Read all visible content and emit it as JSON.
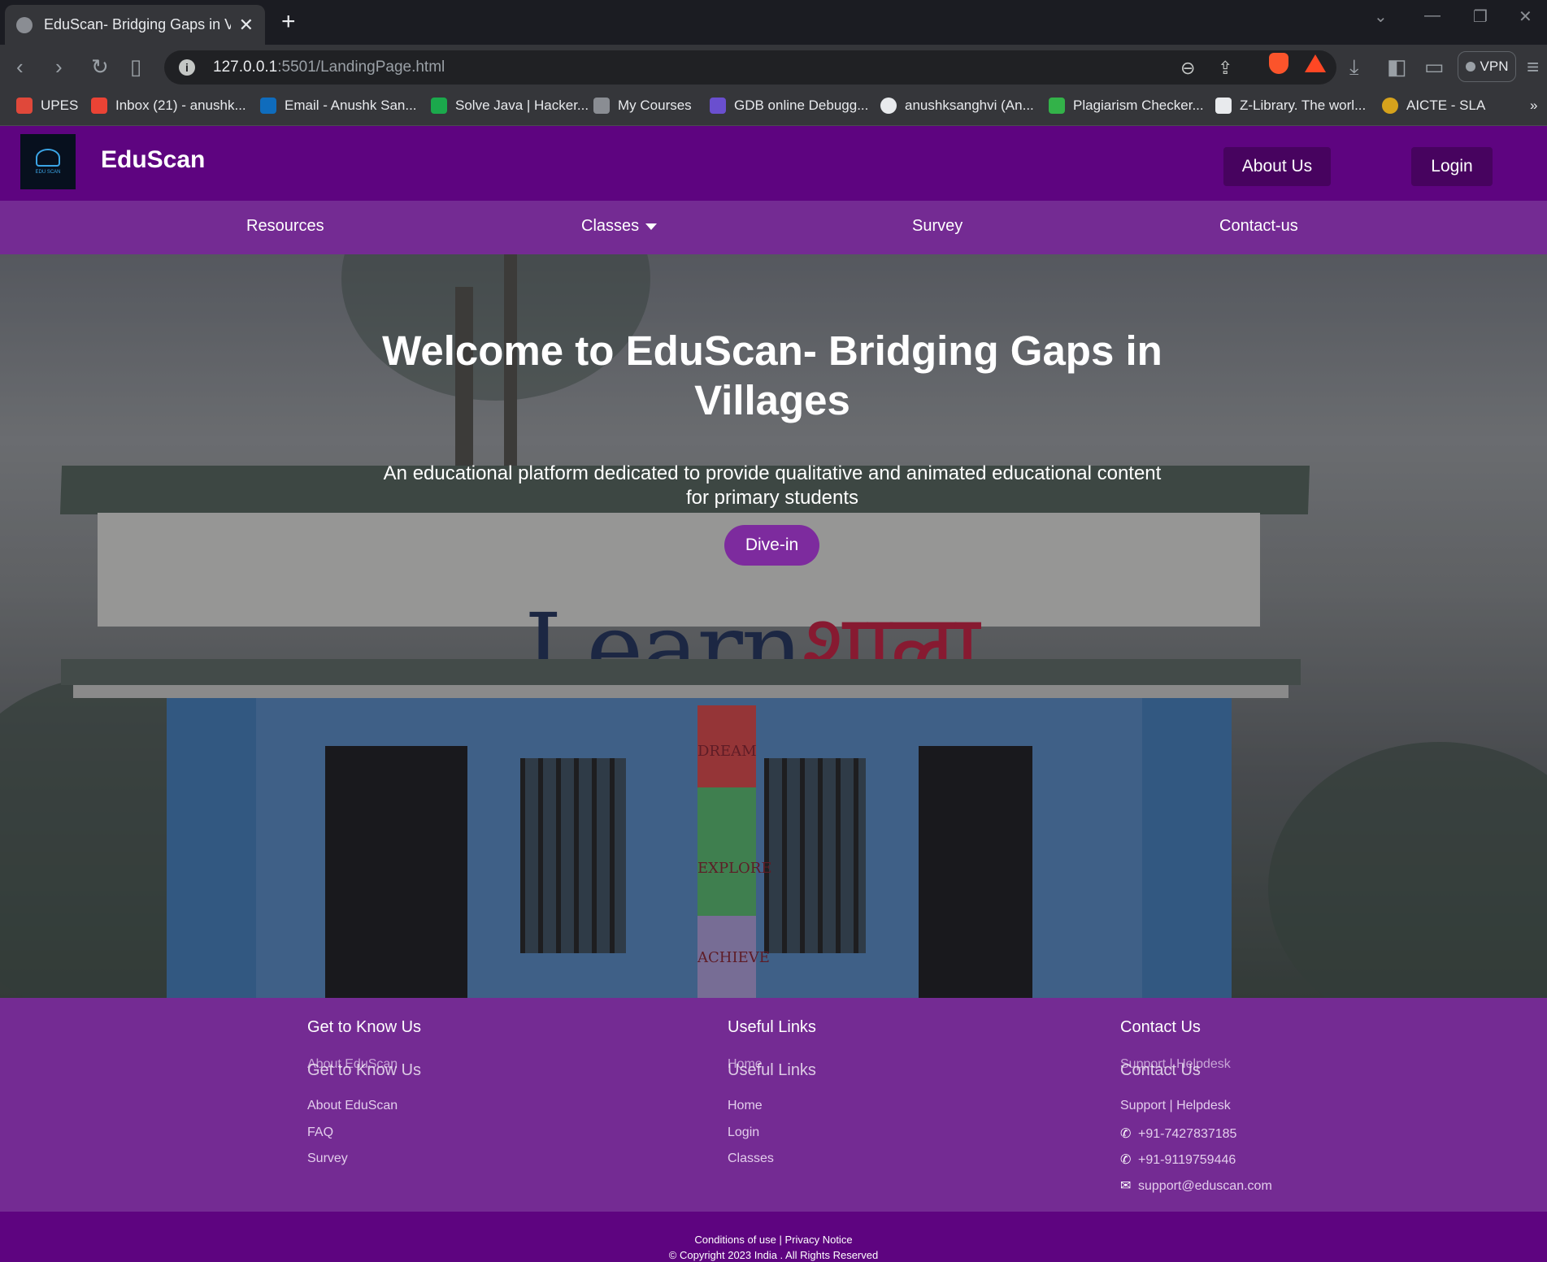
{
  "browser": {
    "tab_title": "EduScan- Bridging Gaps in Villag",
    "new_tab_label": "+",
    "url_host": "127.0.0.1",
    "url_path": ":5501/LandingPage.html",
    "vpn_label": "VPN",
    "bookmarks": [
      {
        "label": "UPES",
        "color": "#e0483a"
      },
      {
        "label": "Inbox (21) - anushk...",
        "color": "#ea4335"
      },
      {
        "label": "Email - Anushk San...",
        "color": "#0f6cbd"
      },
      {
        "label": "Solve Java | Hacker...",
        "color": "#1ba94c"
      },
      {
        "label": "My Courses",
        "color": "#8a8d93"
      },
      {
        "label": "GDB online Debugg...",
        "color": "#6a4fcf"
      },
      {
        "label": "anushksanghvi (An...",
        "color": "#e8eaed"
      },
      {
        "label": "Plagiarism Checker...",
        "color": "#33b249"
      },
      {
        "label": "Z-Library. The worl...",
        "color": "#e8eaed"
      },
      {
        "label": "AICTE - SLA",
        "color": "#d6a21c"
      }
    ],
    "more_bookmarks": "»"
  },
  "header": {
    "logo_text": "EDU SCAN",
    "brand": "EduScan",
    "about_button": "About Us",
    "login_button": "Login"
  },
  "nav": {
    "items": [
      "Resources",
      "Classes",
      "Survey",
      "Contact-us"
    ]
  },
  "hero": {
    "title": "Welcome to EduScan- Bridging Gaps in Villages",
    "subtitle": "An educational platform dedicated to provide qualitative and animated educational content for primary students",
    "cta": "Dive-in",
    "sign_learn": "Learn",
    "sign_shala": "शाला",
    "totem_words": [
      "DREAM",
      "EXPLORE",
      "ACHIEVE"
    ]
  },
  "footer": {
    "col1": {
      "heading": "Get to Know Us",
      "links": [
        "About EduScan",
        "FAQ",
        "Survey"
      ]
    },
    "col2": {
      "heading": "Useful Links",
      "links": [
        "Home",
        "Login",
        "Classes"
      ]
    },
    "col3": {
      "heading": "Contact Us",
      "helpdesk": "Support | Helpdesk",
      "phone1": "+91-7427837185",
      "phone2": "+91-9119759446",
      "email": "support@eduscan.com"
    },
    "legal": "Conditions of use | Privacy Notice",
    "copyright": "© Copyright 2023 India . All Rights Reserved"
  },
  "colors": {
    "header": "#5e0480",
    "nav": "#742b93",
    "accent": "#7d2b9e"
  }
}
